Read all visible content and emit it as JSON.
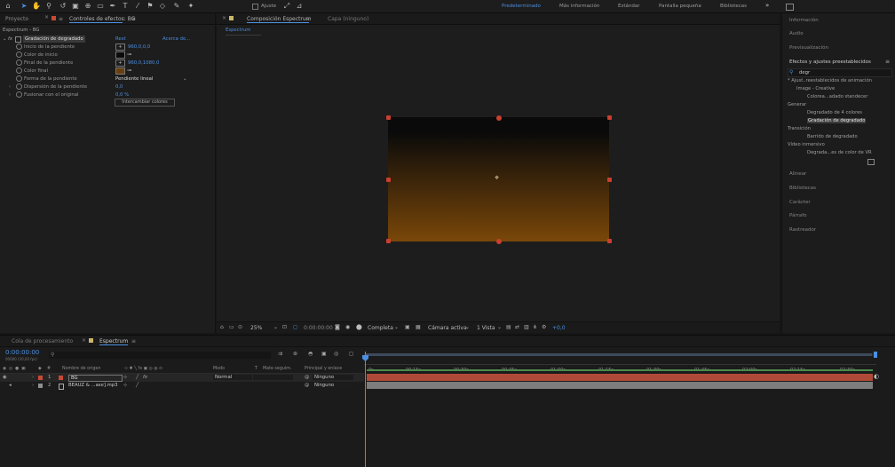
{
  "toolbar": {
    "snap_label": "Ajuste",
    "workspaces": [
      "Predeterminado",
      "Más información",
      "Estándar",
      "Pantalla pequeña",
      "Bibliotecas"
    ],
    "more_label": "»"
  },
  "left_panel": {
    "tabs": [
      "Proyecto",
      "Controles de efectos: BG"
    ],
    "layer_path": "Espectrum - BG",
    "effect": {
      "name": "Gradación de degradado",
      "reset_label": "Rest",
      "about_label": "Acerca de..."
    },
    "properties": [
      {
        "label": "Inicio de la pendiente",
        "value": "960,0,0,0"
      },
      {
        "label": "Color de inicio",
        "value": ""
      },
      {
        "label": "Final de la pendiente",
        "value": "960,0,1080,0"
      },
      {
        "label": "Color final",
        "value": ""
      },
      {
        "label": "Forma de la pendiente",
        "value": "Pendiente lineal"
      },
      {
        "label": "Dispersión de la pendiente",
        "value": "0,0"
      },
      {
        "label": "Fusionar con el original",
        "value": "0,0 %"
      }
    ],
    "swap_colors_label": "Intercambiar colores",
    "colors": {
      "start": "#0a0a0a",
      "end": "#6b3f0c"
    }
  },
  "comp_panel": {
    "tabs": [
      "Composición Espectrum",
      "Capa (ninguno)"
    ],
    "subtab": "Espectrum",
    "bottom_bar": {
      "zoom": "25%",
      "timecode": "0:00:00:00",
      "resolution": "Completa",
      "camera": "Cámara activa",
      "views": "1 Vista",
      "exposure": "+0,0"
    },
    "gradient": {
      "top": "#0a0a0a",
      "bottom": "#7a4709"
    }
  },
  "right_panel": {
    "sections": [
      "Información",
      "Audio",
      "Previsualización"
    ],
    "effects_title": "Efectos y ajustes preestablecidos",
    "search_value": "degr",
    "tree": [
      {
        "label": "* Ajust..reestablecidos de animación",
        "indent": 0
      },
      {
        "label": "Image - Creative",
        "indent": 1
      },
      {
        "label": "Colorea...adado standecer",
        "indent": 2
      },
      {
        "label": "Generar",
        "indent": 0
      },
      {
        "label": "Degradado de 4 colores",
        "indent": 1
      },
      {
        "label": "Gradación de degradado",
        "indent": 1
      },
      {
        "label": "Transición",
        "indent": 0
      },
      {
        "label": "Barrido de degradado",
        "indent": 1
      },
      {
        "label": "Vídeo inmersivo",
        "indent": 0
      },
      {
        "label": "Degrada...es de color de VR",
        "indent": 1
      }
    ],
    "more_sections": [
      "Alinear",
      "Bibliotecas",
      "Carácter",
      "Párrafo",
      "Rastreador"
    ]
  },
  "timeline": {
    "tabs": [
      "Cola de procesamiento",
      "Espectrum"
    ],
    "timecode": "0:00:00:00",
    "timecode_sub": "00000 (30,00 fps)",
    "headers": {
      "source": "Nombre de origen",
      "mode": "Modo",
      "trkmat": "T",
      "trkmat2": "Mate seguim.",
      "parent": "Principal y enlace"
    },
    "layers": [
      {
        "num": "1",
        "name": "BG",
        "mode": "Normal",
        "parent": "Ninguno",
        "color": "#c74a36"
      },
      {
        "num": "2",
        "name": "BEAUZ & ...ase].mp3",
        "mode": "",
        "parent": "Ninguno",
        "color": "#8f8f8f"
      }
    ],
    "ruler": [
      "0s",
      "00:15s",
      "00:30s",
      "00:45s",
      "01:00s",
      "01:15s",
      "01:30s",
      "01:45s",
      "02:00s",
      "02:15s",
      "02:30s"
    ]
  }
}
